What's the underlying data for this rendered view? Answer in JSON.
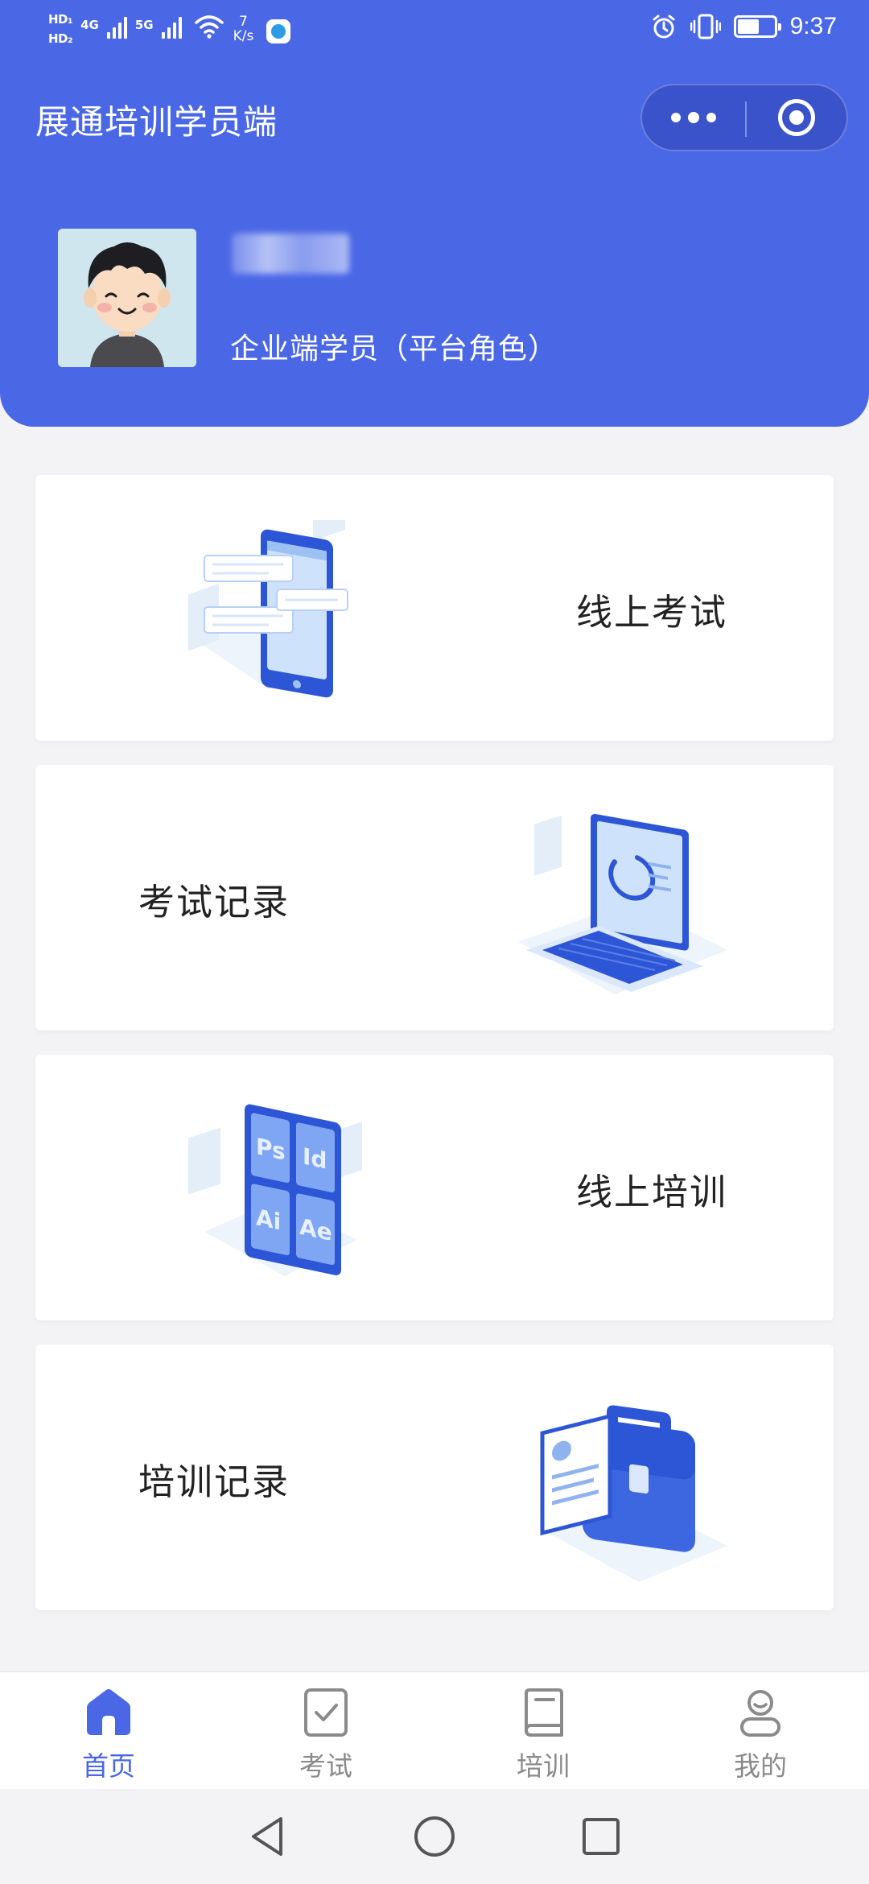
{
  "status_bar": {
    "hd1": "HD₁",
    "hd2": "HD₂",
    "net1": "4G",
    "net2": "5G",
    "speed_value": "7",
    "speed_unit": "K/s",
    "time": "9:37",
    "battery_level": 0.55
  },
  "header": {
    "title": "展通培训学员端",
    "user_role": "企业端学员（平台角色）"
  },
  "cards": [
    {
      "label": "线上考试",
      "icon": "tablet-chat-icon"
    },
    {
      "label": "考试记录",
      "icon": "laptop-chart-icon"
    },
    {
      "label": "线上培训",
      "icon": "design-apps-icon"
    },
    {
      "label": "培训记录",
      "icon": "briefcase-document-icon"
    }
  ],
  "tabbar": {
    "items": [
      {
        "label": "首页",
        "icon": "home-icon",
        "active": true
      },
      {
        "label": "考试",
        "icon": "checklist-icon",
        "active": false
      },
      {
        "label": "培训",
        "icon": "book-icon",
        "active": false
      },
      {
        "label": "我的",
        "icon": "profile-icon",
        "active": false
      }
    ]
  },
  "colors": {
    "primary": "#4a67e6",
    "background": "#f3f3f5",
    "card": "#ffffff",
    "tab_inactive": "#8a8a8a"
  }
}
